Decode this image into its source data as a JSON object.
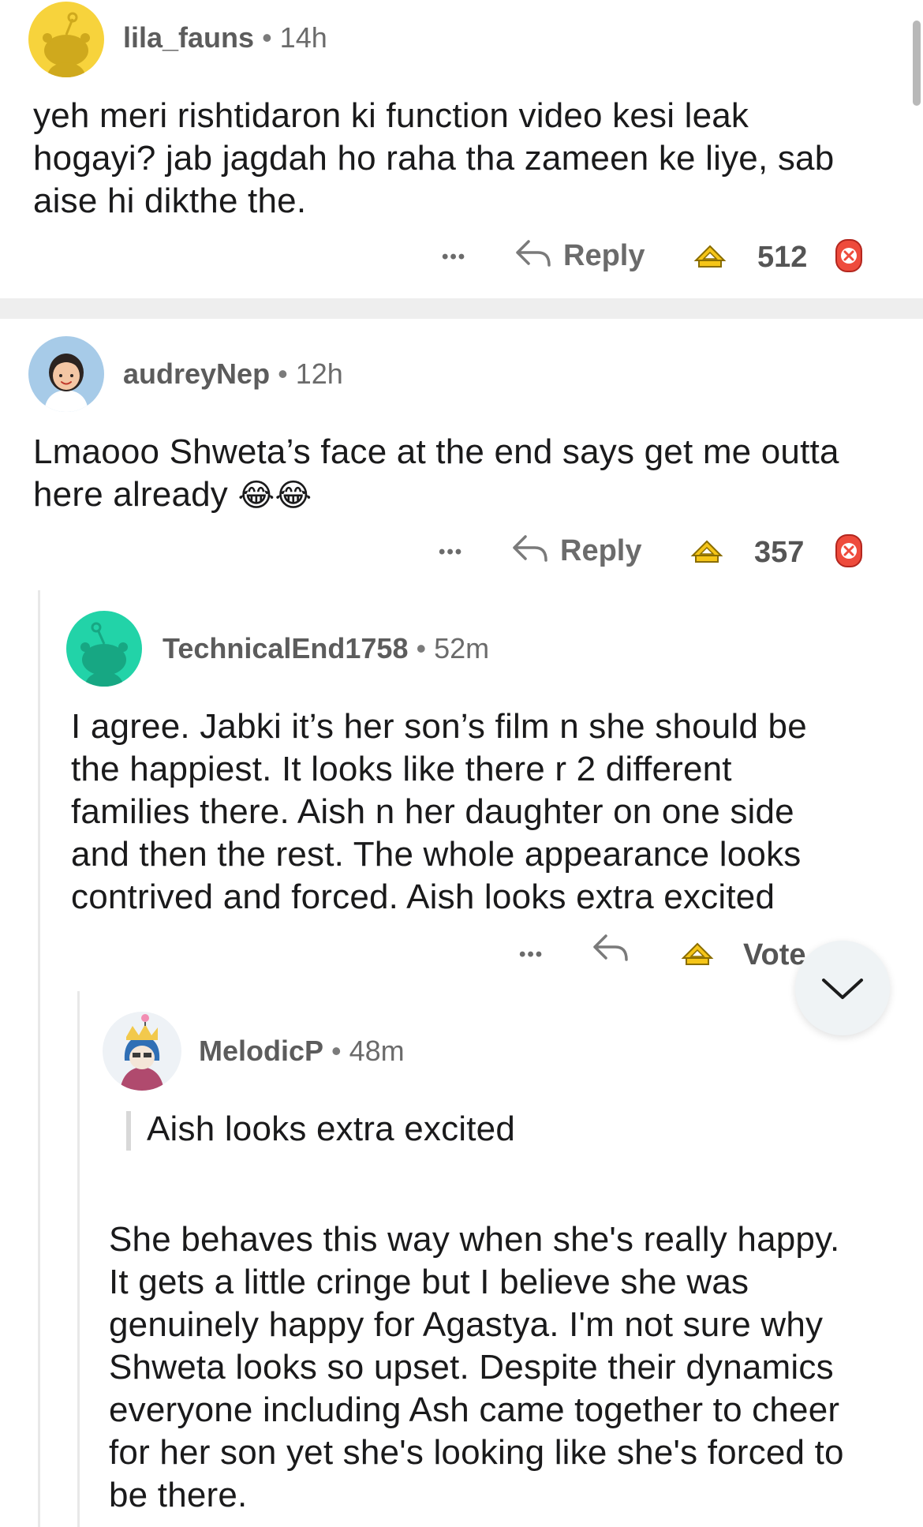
{
  "comments": [
    {
      "username": "lila_fauns",
      "time": "14h",
      "body": "yeh meri rishtidaron ki function video kesi leak\nhogayi? jab jagdah ho raha tha zameen ke liye, sab\naise hi dikthe the.",
      "reply_label": "Reply",
      "score": "512"
    },
    {
      "username": "audreyNep",
      "time": "12h",
      "body": "Lmaooo Shweta’s face at the end says get me outta\nhere already",
      "emoji": "😂😂",
      "reply_label": "Reply",
      "score": "357"
    },
    {
      "username": "TechnicalEnd1758",
      "time": "52m",
      "body": "I agree. Jabki it’s her son’s film n she should be\nthe happiest. It looks like there r 2 different\nfamilies there. Aish n her daughter on one side\nand then the rest. The whole appearance looks\ncontrived and forced. Aish looks extra excited",
      "vote_label": "Vote"
    },
    {
      "username": "MelodicP",
      "time": "48m",
      "quote": "Aish looks extra excited",
      "body": "She behaves this way when she's really happy.\nIt gets a little cringe but I believe she was\ngenuinely happy for Agastya. I'm not sure why\nShweta looks so upset.  Despite their dynamics\neveryone including Ash came together to cheer\nfor her son yet she's looking like she's forced to\nbe there."
    }
  ],
  "more_label": "•••",
  "separator": "•",
  "icons": {
    "reply": "reply-arrow-icon",
    "upvote": "upvote-award-icon",
    "downvote": "downvote-award-icon",
    "jump": "chevron-down-icon"
  },
  "colors": {
    "avatar_1": "#f7d33c",
    "avatar_2": "#a7cbe8",
    "avatar_3": "#22d3a8",
    "downvote": "#ee4b3c",
    "upvote": "#f5c518"
  }
}
